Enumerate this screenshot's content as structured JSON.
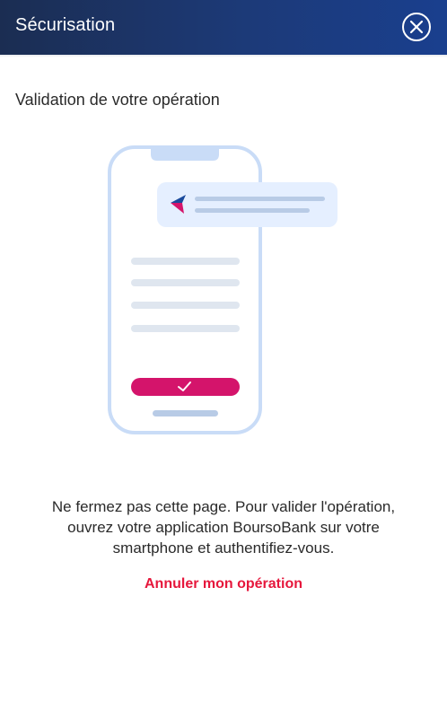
{
  "header": {
    "title": "Sécurisation",
    "close_icon": "close-circle-icon"
  },
  "main": {
    "section_title": "Validation de votre opération",
    "illustration_icon": "phone-validation-illustration",
    "message_line1": "Ne fermez pas cette page. Pour valider l'opération,",
    "message_line2": "ouvrez votre application BoursoBank sur votre",
    "message_line3": "smartphone et authentifiez-vous.",
    "cancel_label": "Annuler mon opération"
  },
  "colors": {
    "header_bg": "#1c3a78",
    "accent_pink": "#d4146b",
    "link_red": "#e6173c",
    "phone_outline": "#c9dcf7",
    "line_gray": "#dfe6ef"
  }
}
